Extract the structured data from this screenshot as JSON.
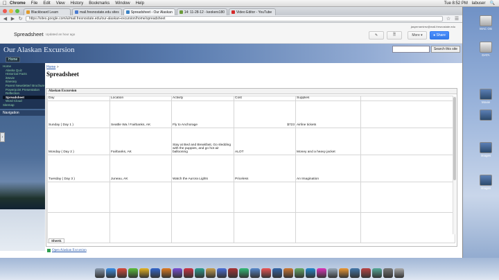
{
  "menubar": {
    "app": "Chrome",
    "items": [
      "File",
      "Edit",
      "View",
      "History",
      "Bookmarks",
      "Window",
      "Help"
    ],
    "clock": "Tue 8:52 PM",
    "user": "labuser"
  },
  "browser": {
    "tabs": [
      {
        "label": "Blackboard Learn",
        "color": "#e09b2d"
      },
      {
        "label": "mail.fresnostate.edu sites",
        "color": "#4a7bd0"
      },
      {
        "label": "Spreadsheet - Our Alaskan",
        "color": "#3b82c4",
        "active": true
      },
      {
        "label": "14: 11-28-12 - keokers180",
        "color": "#6a9a3a"
      },
      {
        "label": "Video Editor - YouTube",
        "color": "#d42a2a"
      }
    ],
    "url": "https://sites.google.com/a/mail.fresnostate.edu/our-alaskan-excursion/home/spreadsheet"
  },
  "gsites": {
    "title": "Spreadsheet",
    "updated": "Updated an hour ago",
    "account": "jasperramirez@mail.fresnostate.edu",
    "more_label": "More",
    "share_label": "Share"
  },
  "site": {
    "name": "Our Alaskan Excursion",
    "search_placeholder": "",
    "search_button": "Search this site",
    "home_button": "Home"
  },
  "sidebar": {
    "items": [
      {
        "label": "Home",
        "top": true
      },
      {
        "label": "Alaska Quiz"
      },
      {
        "label": "Historical Facts"
      },
      {
        "label": "iMovie"
      },
      {
        "label": "Itinerary"
      },
      {
        "label": "Parent Newsletter/ Brochure"
      },
      {
        "label": "Powerpoint Presentation"
      },
      {
        "label": "Reflection"
      },
      {
        "label": "Spreadsheet",
        "active": true
      },
      {
        "label": "Word Cloud"
      },
      {
        "label": "Sitemap",
        "top": true
      }
    ],
    "nav_heading": "Navigation"
  },
  "content": {
    "breadcrumb": "Home",
    "breadcrumb_sep": " >",
    "page_title": "Spreadsheet",
    "sheet_title": "Alaskan Excursion",
    "headers": [
      "Day",
      "Location",
      "Activity",
      "Cost",
      "Supplies"
    ],
    "rows": [
      [
        "Sunday ( Day 1 )",
        "Seattle Wa / Fairbanks, AK",
        "Fly to Anchorage",
        "$723",
        "Airline tickets"
      ],
      [
        "Monday ( Day 2 )",
        "Fairbanks, AK",
        "Stay at Bed and Breakfast, Go sledding with the puppies, and go hot air ballooning",
        "ALOT",
        "Money and a heavy jacket"
      ],
      [
        "Tuesday ( Day 3 )",
        "Juneau, AK",
        "Watch the Aurora Lights",
        "Priceless",
        "An Imagination"
      ]
    ],
    "sheet_tab": "Sheet1",
    "open_link": "Open Alaskan Excursion"
  },
  "desktop": {
    "icons": [
      {
        "label": "MAC OS",
        "kind": "drive"
      },
      {
        "label": "DATA",
        "kind": "drive"
      },
      {
        "label": "Movie",
        "kind": "img"
      },
      {
        "label": "",
        "kind": "img"
      },
      {
        "label": "images",
        "kind": "img"
      },
      {
        "label": "images",
        "kind": "img"
      }
    ]
  },
  "dock": {
    "colors": [
      "#8a9bb0",
      "#3a8ee6",
      "#d94a3a",
      "#5bbf3a",
      "#e6b422",
      "#3366cc",
      "#e07b22",
      "#7a4ed6",
      "#cc3344",
      "#2b9e8f",
      "#c8a050",
      "#4a6fd8",
      "#a33",
      "#3b7",
      "#58c",
      "#e55",
      "#36a",
      "#c73",
      "#6a6",
      "#28c",
      "#d3b",
      "#9ab",
      "#e93",
      "#47a",
      "#b44",
      "#5a9",
      "#777",
      "#aaa"
    ]
  }
}
